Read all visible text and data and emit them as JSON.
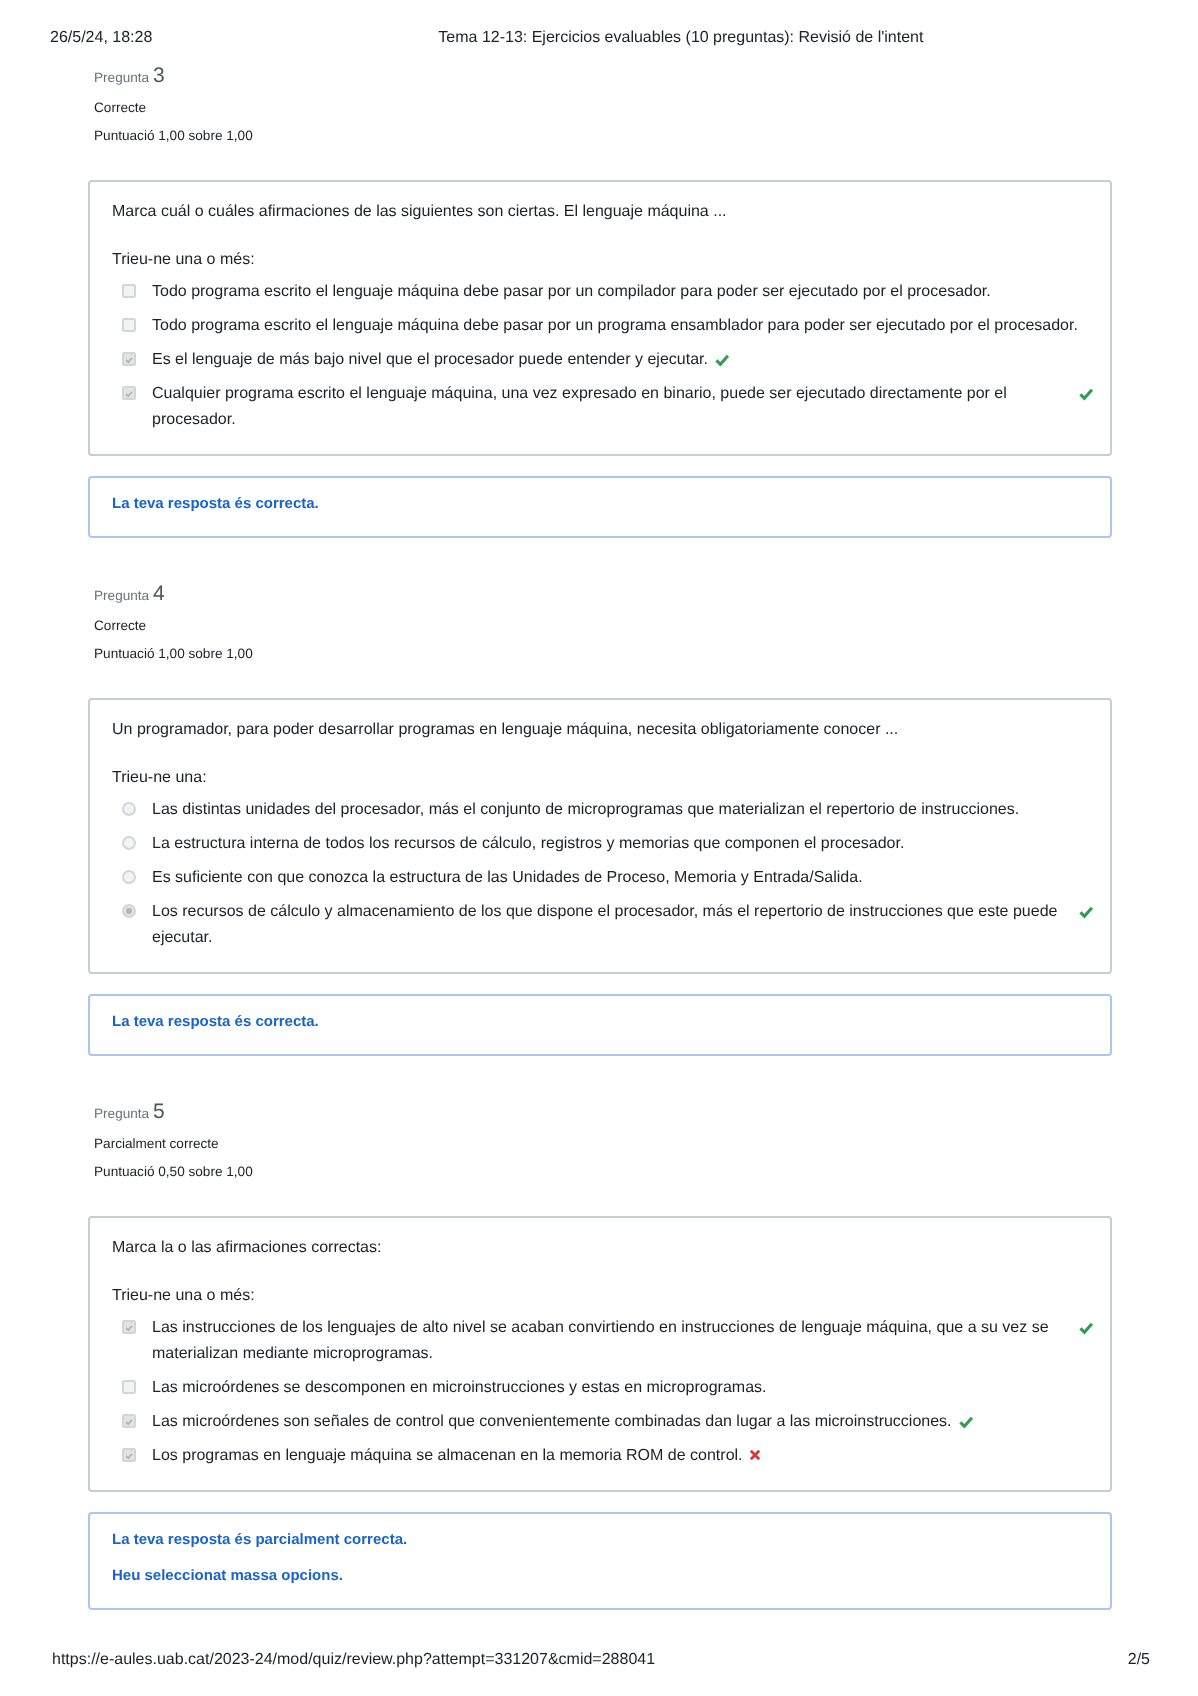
{
  "print_header": {
    "date": "26/5/24, 18:28",
    "title": "Tema 12-13: Ejercicios evaluables (10 preguntas): Revisió de l'intent"
  },
  "questions": [
    {
      "label": "Pregunta",
      "number": "3",
      "state": "Correcte",
      "grade": "Puntuació 1,00 sobre 1,00",
      "text": "Marca cuál o cuáles afirmaciones de las siguientes son ciertas. El lenguaje máquina ...",
      "prompt": "Trieu-ne una o més:",
      "options": [
        {
          "kind": "checkbox",
          "checked": false,
          "text": "Todo programa escrito el lenguaje máquina debe pasar por un compilador para poder ser ejecutado por el procesador.",
          "marked_correct": false,
          "marked_incorrect": false
        },
        {
          "kind": "checkbox",
          "checked": false,
          "text": "Todo programa escrito el lenguaje máquina debe pasar por un programa ensamblador para poder ser ejecutado por el procesador.",
          "marked_correct": false,
          "marked_incorrect": false
        },
        {
          "kind": "checkbox",
          "checked": true,
          "text": "Es el lenguaje de más bajo nivel que el procesador puede entender y ejecutar.",
          "marked_correct": true,
          "marked_incorrect": false
        },
        {
          "kind": "checkbox",
          "checked": true,
          "text": "Cualquier programa escrito el lenguaje máquina, una vez expresado en binario, puede ser ejecutado directamente por el procesador.",
          "marked_correct": true,
          "marked_incorrect": false
        }
      ],
      "feedback": [
        "La teva resposta és correcta."
      ]
    },
    {
      "label": "Pregunta",
      "number": "4",
      "state": "Correcte",
      "grade": "Puntuació 1,00 sobre 1,00",
      "text": "Un programador, para poder desarrollar programas en lenguaje máquina, necesita obligatoriamente conocer ...",
      "prompt": "Trieu-ne una:",
      "options": [
        {
          "kind": "radio",
          "checked": false,
          "text": "Las distintas unidades del procesador, más el conjunto de microprogramas que materializan el repertorio de instrucciones.",
          "marked_correct": false,
          "marked_incorrect": false
        },
        {
          "kind": "radio",
          "checked": false,
          "text": "La estructura interna de todos los recursos de cálculo, registros y memorias que componen el procesador.",
          "marked_correct": false,
          "marked_incorrect": false
        },
        {
          "kind": "radio",
          "checked": false,
          "text": "Es suficiente con que conozca la estructura de las Unidades de Proceso, Memoria y Entrada/Salida.",
          "marked_correct": false,
          "marked_incorrect": false
        },
        {
          "kind": "radio",
          "checked": true,
          "text": "Los recursos de cálculo y almacenamiento de los que dispone el procesador, más el repertorio de instrucciones que este puede ejecutar.",
          "marked_correct": true,
          "marked_incorrect": false
        }
      ],
      "feedback": [
        "La teva resposta és correcta."
      ]
    },
    {
      "label": "Pregunta",
      "number": "5",
      "state": "Parcialment correcte",
      "grade": "Puntuació 0,50 sobre 1,00",
      "text": "Marca la o las afirmaciones correctas:",
      "prompt": "Trieu-ne una o més:",
      "options": [
        {
          "kind": "checkbox",
          "checked": true,
          "text": "Las instrucciones de los lenguajes de alto nivel se acaban convirtiendo en instrucciones de lenguaje máquina, que a su vez se materializan mediante microprogramas.",
          "marked_correct": true,
          "marked_incorrect": false
        },
        {
          "kind": "checkbox",
          "checked": false,
          "text": "Las microórdenes se descomponen en microinstrucciones y estas en microprogramas.",
          "marked_correct": false,
          "marked_incorrect": false
        },
        {
          "kind": "checkbox",
          "checked": true,
          "text": "Las microórdenes son señales de control que convenientemente combinadas dan lugar a las microinstrucciones.",
          "marked_correct": true,
          "marked_incorrect": false
        },
        {
          "kind": "checkbox",
          "checked": true,
          "text": "Los programas en lenguaje máquina se almacenan en la memoria ROM de control.",
          "marked_correct": false,
          "marked_incorrect": true
        }
      ],
      "feedback": [
        "La teva resposta és parcialment correcta.",
        "Heu seleccionat massa opcions."
      ]
    }
  ],
  "print_footer": {
    "url": "https://e-aules.uab.cat/2023-24/mod/quiz/review.php?attempt=331207&cmid=288041",
    "page": "2/5"
  }
}
